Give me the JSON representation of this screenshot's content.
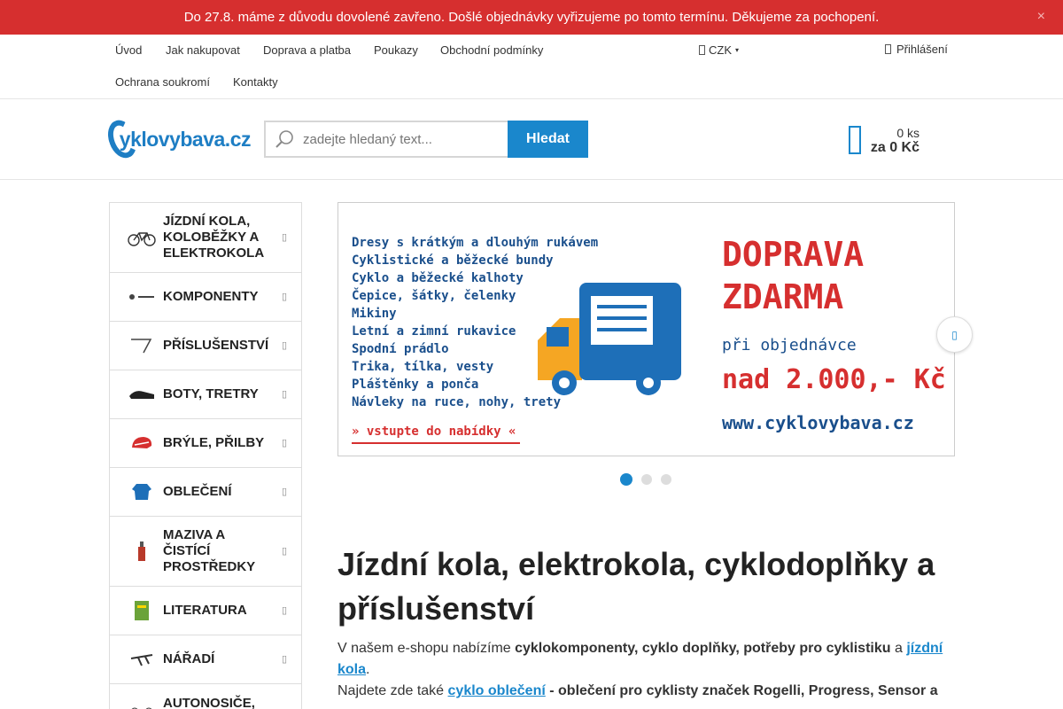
{
  "notice": {
    "text": "Do 27.8. máme z důvodu dovolené zavřeno. Došlé objednávky vyřizujeme po tomto termínu. Děkujeme za pochopení.",
    "close": "×"
  },
  "topnav": {
    "links": [
      "Úvod",
      "Jak nakupovat",
      "Doprava a platba",
      "Poukazy",
      "Obchodní podmínky",
      "Ochrana soukromí",
      "Kontakty"
    ],
    "currency": "CZK",
    "login": "Přihlášení"
  },
  "header": {
    "logo_text": "yklovybava.cz",
    "search_placeholder": "zadejte hledaný text...",
    "search_button": "Hledat",
    "cart_qty": "0 ks",
    "cart_total": "za 0 Kč"
  },
  "sidebar": {
    "categories": [
      {
        "label": "JÍZDNÍ KOLA, KOLOBĚŽKY A ELEKTROKOLA",
        "icon": "bicycle-icon"
      },
      {
        "label": "KOMPONENTY",
        "icon": "components-icon"
      },
      {
        "label": "PŘÍSLUŠENSTVÍ",
        "icon": "accessories-icon"
      },
      {
        "label": "BOTY, TRETRY",
        "icon": "shoe-icon"
      },
      {
        "label": "BRÝLE, PŘILBY",
        "icon": "helmet-icon"
      },
      {
        "label": "OBLEČENÍ",
        "icon": "jacket-icon"
      },
      {
        "label": "MAZIVA A ČISTÍCÍ PROSTŘEDKY",
        "icon": "lubricant-icon"
      },
      {
        "label": "LITERATURA",
        "icon": "book-icon"
      },
      {
        "label": "NÁŘADÍ",
        "icon": "tool-icon"
      },
      {
        "label": "AUTONOSIČE,",
        "icon": "carrier-icon"
      }
    ]
  },
  "banner": {
    "list": [
      "Dresy s krátkým a dlouhým rukávem",
      "Cyklistické a běžecké bundy",
      "Cyklo a běžecké kalhoty",
      "Čepice, šátky, čelenky",
      "Mikiny",
      "Letní a zimní rukavice",
      "Spodní prádlo",
      "Trika, tílka, vesty",
      "Pláštěnky a ponča",
      "Návleky na ruce, nohy, trety"
    ],
    "cta": "» vstupte do nabídky «",
    "head1": "DOPRAVA",
    "head2": "ZDARMA",
    "sub": "při objednávce",
    "price": "nad 2.000,- Kč",
    "url": "www.cyklovybava.cz",
    "active_slide": 1,
    "slide_count": 3
  },
  "content": {
    "title": "Jízdní kola, elektrokola, cyklodoplňky a příslušenství",
    "p1_a": "V našem e-shopu nabízíme ",
    "p1_b": "cyklokomponenty, cyklo doplňky, potřeby pro cyklistiku",
    "p1_c": " a ",
    "p1_link": "jízdní kola",
    "p1_d": ".",
    "p2_a": "Najdete zde také ",
    "p2_link": "cyklo oblečení",
    "p2_b": " - oblečení pro cyklisty značek Rogelli, Progress, Sensor a"
  }
}
